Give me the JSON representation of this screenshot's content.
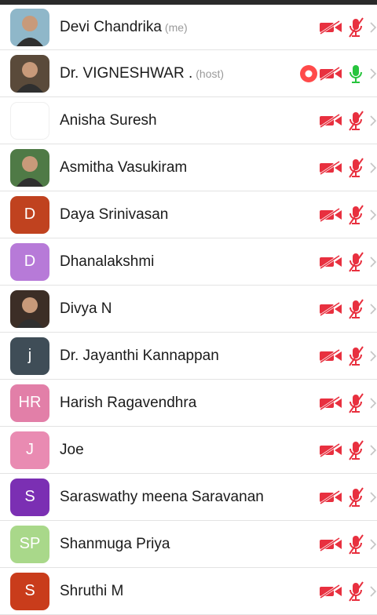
{
  "participants": [
    {
      "name": "Devi Chandrika",
      "tag": "(me)",
      "avatar": {
        "kind": "photo",
        "bg": "#8fb7c9"
      },
      "recording": false,
      "mic": "muted"
    },
    {
      "name": "Dr. VIGNESHWAR .",
      "tag": "(host)",
      "avatar": {
        "kind": "photo",
        "bg": "#5a4a3a"
      },
      "recording": true,
      "mic": "on"
    },
    {
      "name": "Anisha Suresh",
      "tag": "",
      "avatar": {
        "kind": "blank",
        "bg": "#ffffff"
      },
      "recording": false,
      "mic": "muted"
    },
    {
      "name": "Asmitha Vasukiram",
      "tag": "",
      "avatar": {
        "kind": "photo",
        "bg": "#4f7a46"
      },
      "recording": false,
      "mic": "muted"
    },
    {
      "name": "Daya Srinivasan",
      "tag": "",
      "avatar": {
        "kind": "initials",
        "initials": "D",
        "bg": "#c0421f"
      },
      "recording": false,
      "mic": "muted"
    },
    {
      "name": "Dhanalakshmi",
      "tag": "",
      "avatar": {
        "kind": "initials",
        "initials": "D",
        "bg": "#b77ad8"
      },
      "recording": false,
      "mic": "muted"
    },
    {
      "name": "Divya N",
      "tag": "",
      "avatar": {
        "kind": "photo",
        "bg": "#3c2e26"
      },
      "recording": false,
      "mic": "muted"
    },
    {
      "name": "Dr. Jayanthi Kannappan",
      "tag": "",
      "avatar": {
        "kind": "initials",
        "initials": "j",
        "bg": "#3f4d57"
      },
      "recording": false,
      "mic": "muted"
    },
    {
      "name": "Harish Ragavendhra",
      "tag": "",
      "avatar": {
        "kind": "initials",
        "initials": "HR",
        "bg": "#e27fa8"
      },
      "recording": false,
      "mic": "muted"
    },
    {
      "name": "Joe",
      "tag": "",
      "avatar": {
        "kind": "initials",
        "initials": "J",
        "bg": "#e98bb2"
      },
      "recording": false,
      "mic": "muted"
    },
    {
      "name": "Saraswathy meena Saravanan",
      "tag": "",
      "avatar": {
        "kind": "initials",
        "initials": "S",
        "bg": "#7b2fb3"
      },
      "recording": false,
      "mic": "muted"
    },
    {
      "name": "Shanmuga Priya",
      "tag": "",
      "avatar": {
        "kind": "initials",
        "initials": "SP",
        "bg": "#a9d88a"
      },
      "recording": false,
      "mic": "muted"
    },
    {
      "name": "Shruthi M",
      "tag": "",
      "avatar": {
        "kind": "initials",
        "initials": "S",
        "bg": "#c93c1b"
      },
      "recording": false,
      "mic": "muted"
    }
  ],
  "colors": {
    "muted_red": "#e8303f",
    "mic_on_green": "#27c43d",
    "recording": "#ff4a4a",
    "chevron": "#c4c4c4",
    "divider": "#e3e3e3"
  },
  "icons": {
    "camera_off": "video-off-icon",
    "mic_muted": "mic-muted-icon",
    "mic_on": "mic-on-icon",
    "recording": "record-icon",
    "chevron": "chevron-right-icon"
  }
}
